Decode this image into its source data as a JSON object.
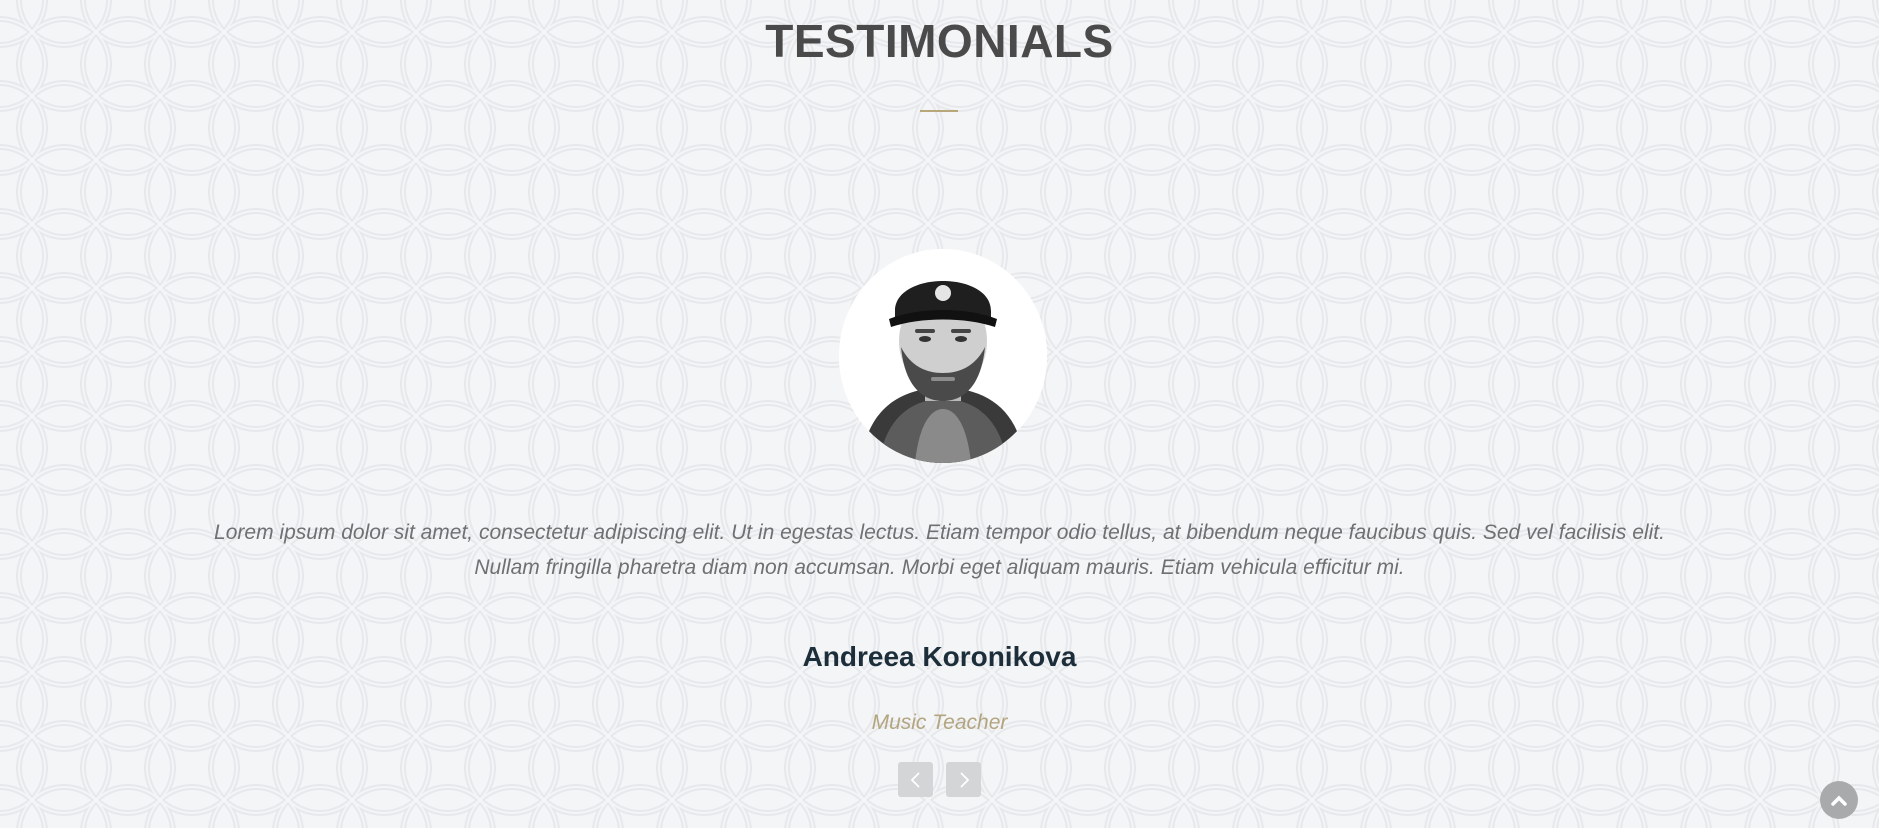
{
  "testimonials": {
    "title": "TESTIMONIALS",
    "accent_color": "#b9a77c",
    "current": {
      "quote": "Lorem ipsum dolor sit amet, consectetur adipiscing elit. Ut in egestas lectus. Etiam tempor odio tellus, at bibendum neque faucibus quis. Sed vel facilisis elit. Nullam fringilla pharetra diam non accumsan. Morbi eget aliquam mauris. Etiam vehicula efficitur mi.",
      "name": "Andreea Koronikova",
      "role": "Music Teacher"
    },
    "controls": {
      "prev_icon": "chevron-left-icon",
      "next_icon": "chevron-right-icon"
    }
  },
  "scroll_top": {
    "icon": "chevron-up-icon"
  }
}
